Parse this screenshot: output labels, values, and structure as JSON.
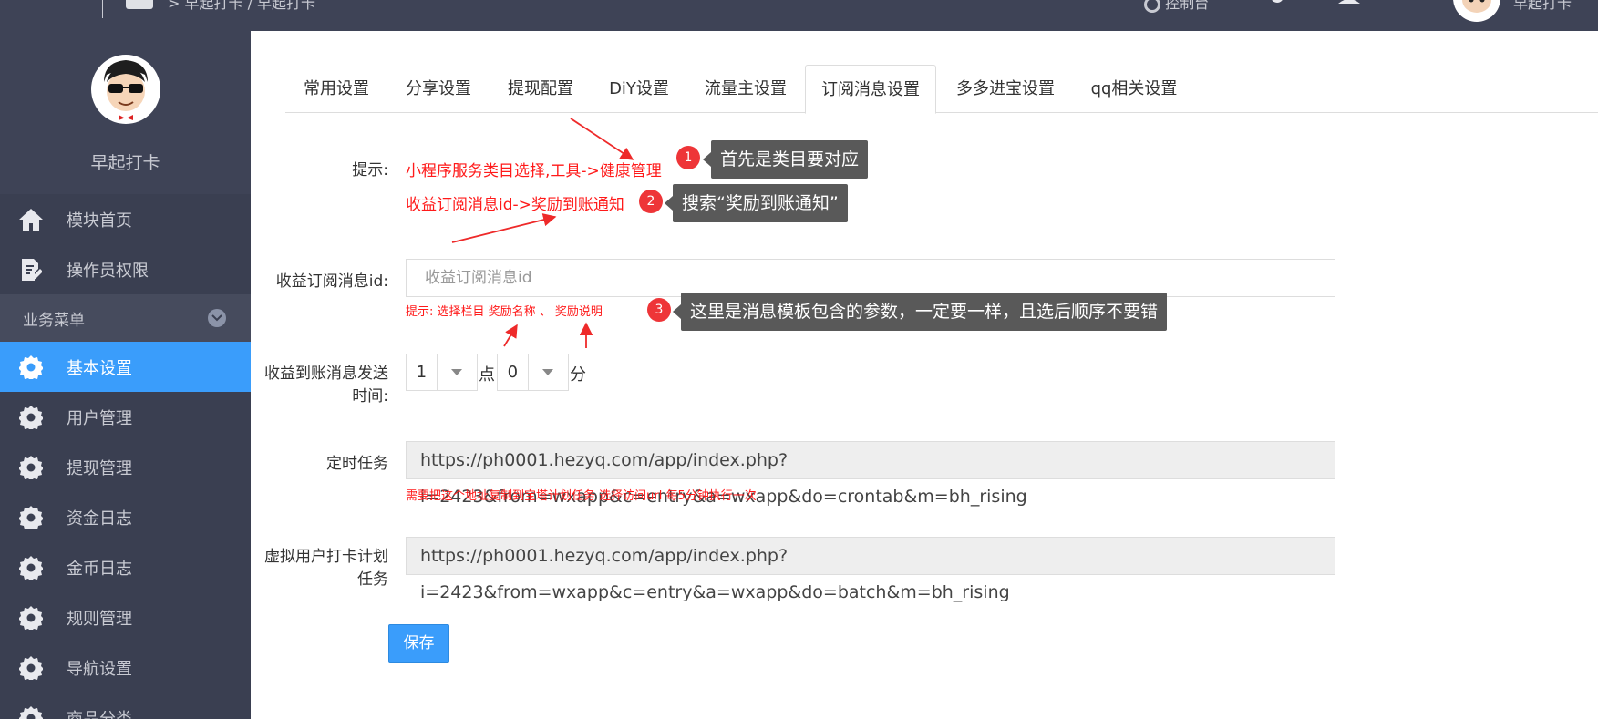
{
  "topbar": {
    "breadcrumb": "> 早起打卡 / 早起打卡",
    "item_1": "控制台",
    "user_name": "早起打卡"
  },
  "sidebar": {
    "brand": "早起打卡",
    "items_top": [
      {
        "label": "模块首页",
        "icon": "home-icon"
      },
      {
        "label": "操作员权限",
        "icon": "edit-doc-icon"
      }
    ],
    "section_label": "业务菜单",
    "items": [
      {
        "label": "基本设置",
        "icon": "gear-icon",
        "active": true
      },
      {
        "label": "用户管理",
        "icon": "gear-icon"
      },
      {
        "label": "提现管理",
        "icon": "gear-icon"
      },
      {
        "label": "资金日志",
        "icon": "gear-icon"
      },
      {
        "label": "金币日志",
        "icon": "gear-icon"
      },
      {
        "label": "规则管理",
        "icon": "gear-icon"
      },
      {
        "label": "导航设置",
        "icon": "gear-icon"
      },
      {
        "label": "商品分类",
        "icon": "gear-icon"
      }
    ]
  },
  "tabs": [
    {
      "label": "常用设置"
    },
    {
      "label": "分享设置"
    },
    {
      "label": "提现配置"
    },
    {
      "label": "DiY设置"
    },
    {
      "label": "流量主设置"
    },
    {
      "label": "订阅消息设置",
      "active": true
    },
    {
      "label": "多多进宝设置"
    },
    {
      "label": "qq相关设置"
    }
  ],
  "form": {
    "tip_label": "提示:",
    "tip_line1": "小程序服务类目选择,工具->健康管理",
    "tip_line2": "收益订阅消息id->奖励到账通知",
    "sub_id_label": "收益订阅消息id:",
    "sub_id_placeholder": "收益订阅消息id",
    "sub_id_hint": "提示: 选择栏目 奖励名称 、 奖励说明",
    "send_time_label": "收益到账消息发送时间:",
    "hour_value": "1",
    "hour_unit": "点",
    "minute_value": "0",
    "minute_unit": "分",
    "cron_label": "定时任务",
    "cron_url": "https://ph0001.hezyq.com/app/index.php?i=2423&from=wxapp&c=entry&a=wxapp&do=crontab&m=bh_rising",
    "cron_hint": "需要把这个地址复制到宝塔计划任务 选择访问url 每5分钟执行一次",
    "virtual_label": "虚拟用户打卡计划任务",
    "virtual_url": "https://ph0001.hezyq.com/app/index.php?i=2423&from=wxapp&c=entry&a=wxapp&do=batch&m=bh_rising",
    "save_label": "保存"
  },
  "annotations": [
    {
      "num": "1",
      "text": "首先是类目要对应"
    },
    {
      "num": "2",
      "text": "搜索“奖励到账通知”"
    },
    {
      "num": "3",
      "text": "这里是消息模板包含的参数，一定要一样，且选后顺序不要错"
    }
  ],
  "colors": {
    "sidebar_bg": "#3a3f51",
    "topbar_bg": "#3e4356",
    "accent": "#3a9dfb",
    "hint_red": "#ff1a1a",
    "annotation_red": "#ee3538",
    "callout_bg": "#595959"
  }
}
